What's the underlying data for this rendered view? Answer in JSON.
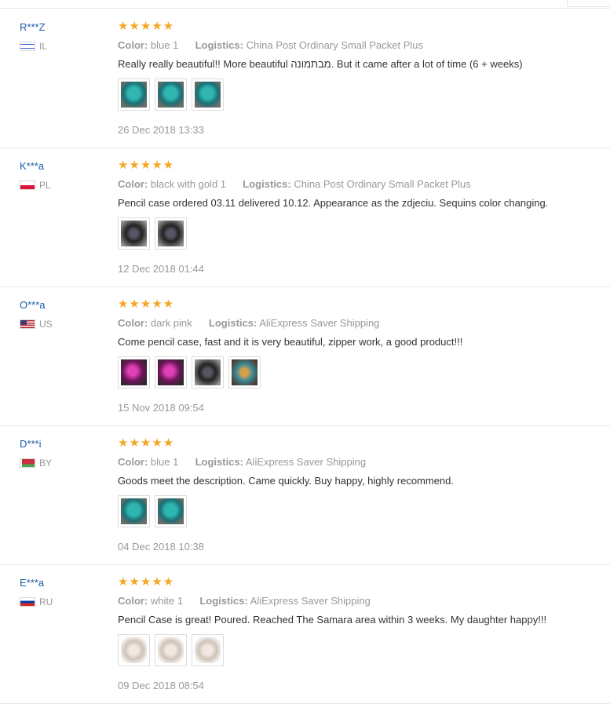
{
  "labels": {
    "color": "Color:",
    "logistics": "Logistics:"
  },
  "colors": {
    "link": "#1a5ba6",
    "star": "#f5a623",
    "muted": "#999999"
  },
  "reviews": [
    {
      "user": "R***Z",
      "country": "IL",
      "stars": "★★★★★",
      "color": "blue 1",
      "logistics": "China Post Ordinary Small Packet Plus",
      "text": "Really really beautiful!! More beautiful מבתמונה. But it came after a lot of time (6 + weeks)",
      "date": "26 Dec 2018 13:33",
      "thumbs": [
        "photo-teal-sequin-case",
        "photo-teal-sequin-case",
        "photo-teal-sequin-case"
      ]
    },
    {
      "user": "K***a",
      "country": "PL",
      "stars": "★★★★★",
      "color": "black with gold 1",
      "logistics": "China Post Ordinary Small Packet Plus",
      "text": "Pencil case ordered 03.11 delivered 10.12. Appearance as the zdjeciu. Sequins color changing.",
      "date": "12 Dec 2018 01:44",
      "thumbs": [
        "photo-black-sequin-case",
        "photo-black-sequin-case"
      ]
    },
    {
      "user": "O***a",
      "country": "US",
      "stars": "★★★★★",
      "color": "dark pink",
      "logistics": "AliExpress Saver Shipping",
      "text": "Come pencil case, fast and it is very beautiful, zipper work, a good product!!!",
      "date": "15 Nov 2018 09:54",
      "thumbs": [
        "photo-pink-sequin-case",
        "photo-pink-sequin-case",
        "photo-black-sequin-case",
        "photo-multicolor-sequin-case"
      ]
    },
    {
      "user": "D***i",
      "country": "BY",
      "stars": "★★★★★",
      "color": "blue 1",
      "logistics": "AliExpress Saver Shipping",
      "text": "Goods meet the description. Came quickly. Buy happy, highly recommend.",
      "date": "04 Dec 2018 10:38",
      "thumbs": [
        "photo-teal-sequin-case",
        "photo-teal-sequin-case"
      ]
    },
    {
      "user": "E***a",
      "country": "RU",
      "stars": "★★★★★",
      "color": "white 1",
      "logistics": "AliExpress Saver Shipping",
      "text": "Pencil Case is great! Poured. Reached The Samara area within 3 weeks. My daughter happy!!!",
      "date": "09 Dec 2018 08:54",
      "thumbs": [
        "photo-white-sequin-case",
        "photo-white-sequin-case",
        "photo-white-sequin-case"
      ]
    }
  ]
}
